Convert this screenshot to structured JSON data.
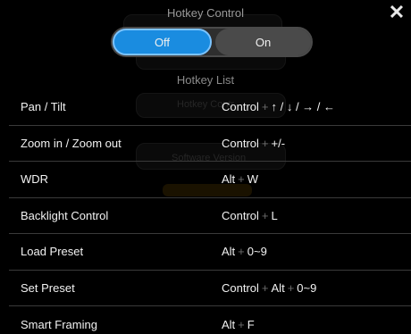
{
  "header": {
    "title": "Hotkey Control",
    "close_icon": "close-icon"
  },
  "toggle": {
    "off_label": "Off",
    "on_label": "On",
    "selected": "Off",
    "active_color": "#1a8ce0"
  },
  "list_title": "Hotkey List",
  "background": {
    "ghost_label_1": "Hotkey Contr",
    "ghost_label_2": "Software Version"
  },
  "hotkeys": [
    {
      "name": "Pan / Tilt",
      "keys": [
        "Control",
        "↑ / ↓ / → / ←"
      ]
    },
    {
      "name": "Zoom in / Zoom out",
      "keys": [
        "Control",
        "+/-"
      ]
    },
    {
      "name": "WDR",
      "keys": [
        "Alt",
        "W"
      ]
    },
    {
      "name": "Backlight Control",
      "keys": [
        "Control",
        "L"
      ]
    },
    {
      "name": "Load Preset",
      "keys": [
        "Alt",
        "0~9"
      ]
    },
    {
      "name": "Set Preset",
      "keys": [
        "Control",
        "Alt",
        "0~9"
      ]
    },
    {
      "name": "Smart Framing",
      "keys": [
        "Alt",
        "F"
      ]
    }
  ]
}
